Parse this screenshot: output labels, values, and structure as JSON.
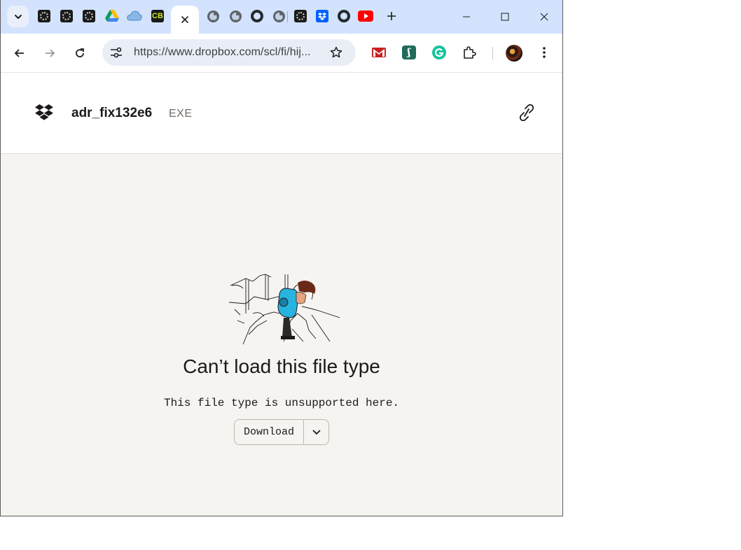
{
  "browser": {
    "url": "https://www.dropbox.com/scl/fi/hij...",
    "pinned_tabs": [
      "tab-1",
      "tab-2",
      "tab-3",
      "google-drive",
      "onedrive",
      "cb",
      "active",
      "globe-1",
      "globe-2",
      "github-1",
      "globe-3",
      "tab-dark-4",
      "dropbox",
      "github-2",
      "youtube"
    ],
    "cb_label": "CB",
    "colors": {
      "tabstrip": "#d3e3fd",
      "toolbar": "#ffffff"
    }
  },
  "page": {
    "file_name": "adr_fix132e6",
    "file_ext": "EXE",
    "message_title": "Can’t load this file type",
    "message_body": "This file type is unsupported here.",
    "download_label": "Download"
  }
}
